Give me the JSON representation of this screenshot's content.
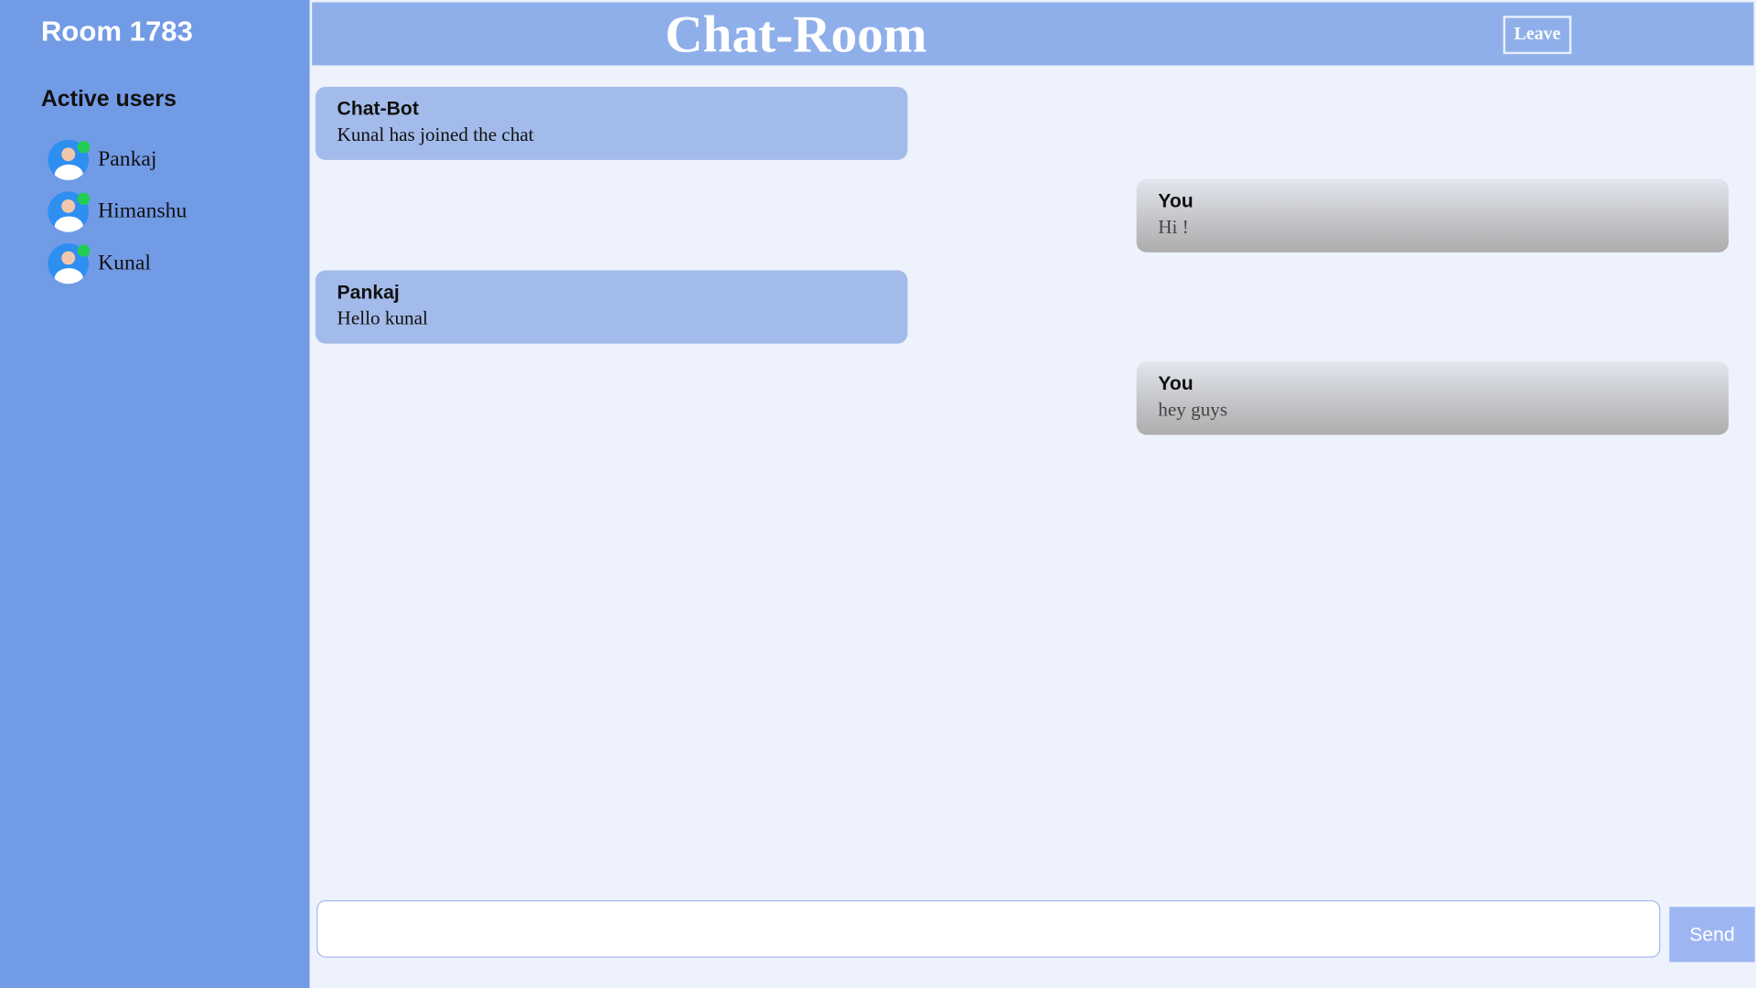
{
  "sidebar": {
    "room_title": "Room 1783",
    "active_heading": "Active users",
    "users": [
      {
        "name": "Pankaj",
        "status": "online"
      },
      {
        "name": "Himanshu",
        "status": "online"
      },
      {
        "name": "Kunal",
        "status": "online"
      }
    ]
  },
  "header": {
    "title": "Chat-Room",
    "leave_label": "Leave"
  },
  "messages": [
    {
      "author": "Chat-Bot",
      "text": "Kunal has joined the chat",
      "side": "left"
    },
    {
      "author": "You",
      "text": "Hi !",
      "side": "right"
    },
    {
      "author": "Pankaj",
      "text": "Hello kunal",
      "side": "left"
    },
    {
      "author": "You",
      "text": "hey guys",
      "side": "right"
    }
  ],
  "composer": {
    "value": "",
    "placeholder": "",
    "send_label": "Send"
  },
  "colors": {
    "sidebar_bg": "#729be6",
    "header_bg": "#8fafea",
    "chat_bg": "#edf2fc",
    "other_message_bg": "#a3bbea",
    "online_indicator": "#22cc55",
    "send_button_bg": "#9db6f2"
  },
  "icons": {
    "avatar": "user-avatar-icon",
    "online": "online-status-icon"
  }
}
